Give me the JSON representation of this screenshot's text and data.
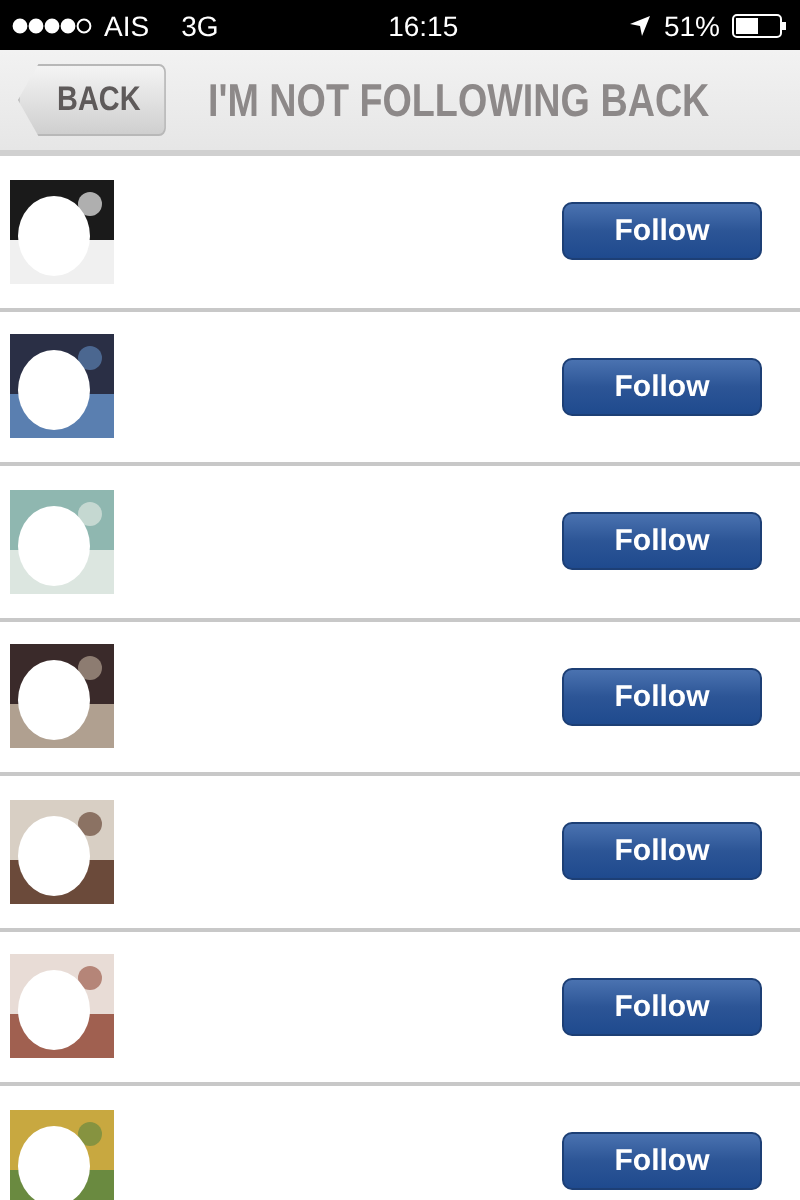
{
  "status_bar": {
    "carrier": "AIS",
    "network": "3G",
    "time": "16:15",
    "battery": "51%"
  },
  "nav": {
    "back": "BACK",
    "title": "I'M NOT FOLLOWING BACK"
  },
  "rows": [
    {
      "button": "Follow"
    },
    {
      "button": "Follow"
    },
    {
      "button": "Follow"
    },
    {
      "button": "Follow"
    },
    {
      "button": "Follow"
    },
    {
      "button": "Follow"
    },
    {
      "button": "Follow"
    }
  ]
}
